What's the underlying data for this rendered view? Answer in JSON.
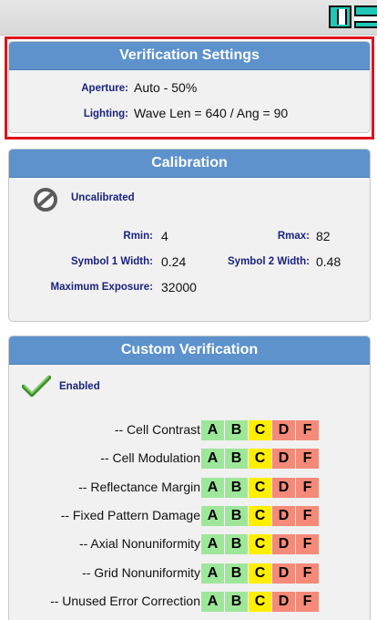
{
  "verification": {
    "title": "Verification Settings",
    "aperture_label": "Aperture:",
    "aperture_value": "Auto - 50%",
    "lighting_label": "Lighting:",
    "lighting_value": "Wave Len = 640 / Ang = 90"
  },
  "calibration": {
    "title": "Calibration",
    "status": "Uncalibrated",
    "status_icon": "prohibited-icon",
    "rmin_label": "Rmin:",
    "rmin_value": "4",
    "rmax_label": "Rmax:",
    "rmax_value": "82",
    "sym1_label": "Symbol 1 Width:",
    "sym1_value": "0.24",
    "sym2_label": "Symbol 2 Width:",
    "sym2_value": "0.48",
    "max_exp_label": "Maximum Exposure:",
    "max_exp_value": "32000"
  },
  "custom": {
    "title": "Custom Verification",
    "status": "Enabled",
    "status_icon": "checkmark-icon",
    "grade_labels": [
      "A",
      "B",
      "C",
      "D",
      "F"
    ],
    "grade_colors": {
      "A": "#9ee79a",
      "B": "#9ee79a",
      "C": "#ffee00",
      "D": "#f48a77",
      "F": "#f48a77"
    },
    "metrics": [
      "-- Cell Contrast",
      "-- Cell Modulation",
      "-- Reflectance Margin",
      "-- Fixed Pattern Damage",
      "-- Axial Nonuniformity",
      "-- Grid Nonuniformity",
      "-- Unused Error Correction"
    ]
  },
  "colors": {
    "header_blue": "#5d92cc",
    "label_navy": "#1a237e",
    "highlight_red": "#e0121b",
    "toolbar_teal": "#1fc8b6"
  }
}
